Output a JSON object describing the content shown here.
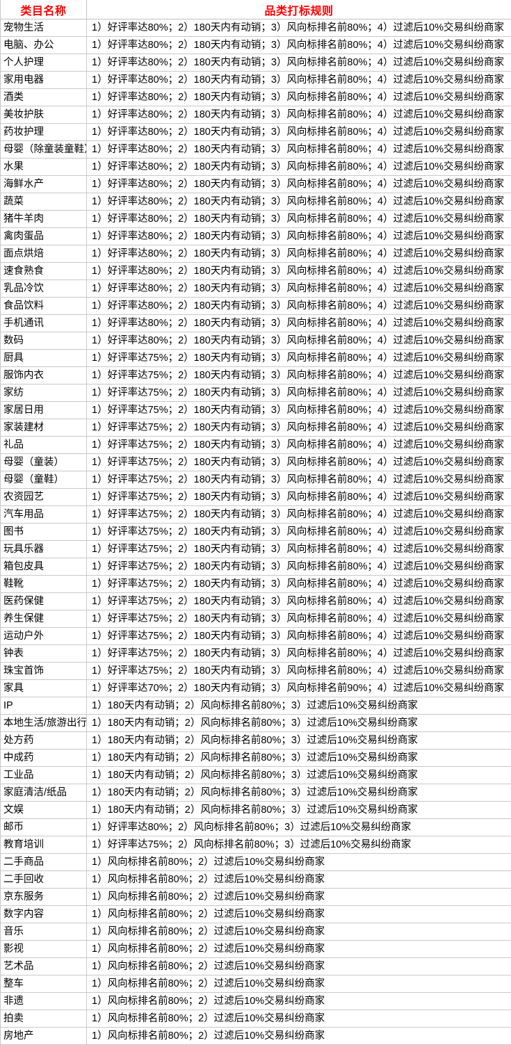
{
  "table": {
    "columns": [
      {
        "key": "name",
        "label": "类目名称"
      },
      {
        "key": "rule",
        "label": "品类打标规则"
      }
    ],
    "header_text_color": "#ff0000",
    "border_color": "#c8c8c8",
    "rows": [
      {
        "name": "宠物生活",
        "rule": "1）好评率达80%；2）180天内有动销；3）风向标排名前80%；4）过滤后10%交易纠纷商家"
      },
      {
        "name": "电脑、办公",
        "rule": "1）好评率达80%；2）180天内有动销；3）风向标排名前80%；4）过滤后10%交易纠纷商家"
      },
      {
        "name": "个人护理",
        "rule": "1）好评率达80%；2）180天内有动销；3）风向标排名前80%；4）过滤后10%交易纠纷商家"
      },
      {
        "name": "家用电器",
        "rule": "1）好评率达80%；2）180天内有动销；3）风向标排名前80%；4）过滤后10%交易纠纷商家"
      },
      {
        "name": "酒类",
        "rule": "1）好评率达80%；2）180天内有动销；3）风向标排名前80%；4）过滤后10%交易纠纷商家"
      },
      {
        "name": "美妆护肤",
        "rule": "1）好评率达80%；2）180天内有动销；3）风向标排名前80%；4）过滤后10%交易纠纷商家"
      },
      {
        "name": "药妆护理",
        "rule": "1）好评率达80%；2）180天内有动销；3）风向标排名前80%；4）过滤后10%交易纠纷商家"
      },
      {
        "name": "母婴（除童装童鞋）",
        "rule": "1）好评率达80%；2）180天内有动销；3）风向标排名前80%；4）过滤后10%交易纠纷商家"
      },
      {
        "name": "水果",
        "rule": "1）好评率达80%；2）180天内有动销；3）风向标排名前80%；4）过滤后10%交易纠纷商家"
      },
      {
        "name": "海鲜水产",
        "rule": "1）好评率达80%；2）180天内有动销；3）风向标排名前80%；4）过滤后10%交易纠纷商家"
      },
      {
        "name": "蔬菜",
        "rule": "1）好评率达80%；2）180天内有动销；3）风向标排名前80%；4）过滤后10%交易纠纷商家"
      },
      {
        "name": "猪牛羊肉",
        "rule": "1）好评率达80%；2）180天内有动销；3）风向标排名前80%；4）过滤后10%交易纠纷商家"
      },
      {
        "name": "禽肉蛋品",
        "rule": "1）好评率达80%；2）180天内有动销；3）风向标排名前80%；4）过滤后10%交易纠纷商家"
      },
      {
        "name": "面点烘焙",
        "rule": "1）好评率达80%；2）180天内有动销；3）风向标排名前80%；4）过滤后10%交易纠纷商家"
      },
      {
        "name": "速食熟食",
        "rule": "1）好评率达80%；2）180天内有动销；3）风向标排名前80%；4）过滤后10%交易纠纷商家"
      },
      {
        "name": "乳品冷饮",
        "rule": "1）好评率达80%；2）180天内有动销；3）风向标排名前80%；4）过滤后10%交易纠纷商家"
      },
      {
        "name": "食品饮料",
        "rule": "1）好评率达80%；2）180天内有动销；3）风向标排名前80%；4）过滤后10%交易纠纷商家"
      },
      {
        "name": "手机通讯",
        "rule": "1）好评率达80%；2）180天内有动销；3）风向标排名前80%；4）过滤后10%交易纠纷商家"
      },
      {
        "name": "数码",
        "rule": "1）好评率达80%；2）180天内有动销；3）风向标排名前80%；4）过滤后10%交易纠纷商家"
      },
      {
        "name": "厨具",
        "rule": "1）好评率达75%；2）180天内有动销；3）风向标排名前80%；4）过滤后10%交易纠纷商家"
      },
      {
        "name": "服饰内衣",
        "rule": "1）好评率达75%；2）180天内有动销；3）风向标排名前80%；4）过滤后10%交易纠纷商家"
      },
      {
        "name": "家纺",
        "rule": "1）好评率达75%；2）180天内有动销；3）风向标排名前80%；4）过滤后10%交易纠纷商家"
      },
      {
        "name": "家居日用",
        "rule": "1）好评率达75%；2）180天内有动销；3）风向标排名前80%；4）过滤后10%交易纠纷商家"
      },
      {
        "name": "家装建材",
        "rule": "1）好评率达75%；2）180天内有动销；3）风向标排名前80%；4）过滤后10%交易纠纷商家"
      },
      {
        "name": "礼品",
        "rule": "1）好评率达75%；2）180天内有动销；3）风向标排名前80%；4）过滤后10%交易纠纷商家"
      },
      {
        "name": "母婴（童装）",
        "rule": "1）好评率达75%；2）180天内有动销；3）风向标排名前80%；4）过滤后10%交易纠纷商家"
      },
      {
        "name": "母婴（童鞋）",
        "rule": "1）好评率达75%；2）180天内有动销；3）风向标排名前80%；4）过滤后10%交易纠纷商家"
      },
      {
        "name": "农资园艺",
        "rule": "1）好评率达75%；2）180天内有动销；3）风向标排名前80%；4）过滤后10%交易纠纷商家"
      },
      {
        "name": "汽车用品",
        "rule": "1）好评率达75%；2）180天内有动销；3）风向标排名前80%；4）过滤后10%交易纠纷商家"
      },
      {
        "name": "图书",
        "rule": "1）好评率达75%；2）180天内有动销；3）风向标排名前80%；4）过滤后10%交易纠纷商家"
      },
      {
        "name": "玩具乐器",
        "rule": "1）好评率达75%；2）180天内有动销；3）风向标排名前80%；4）过滤后10%交易纠纷商家"
      },
      {
        "name": "箱包皮具",
        "rule": "1）好评率达75%；2）180天内有动销；3）风向标排名前80%；4）过滤后10%交易纠纷商家"
      },
      {
        "name": "鞋靴",
        "rule": "1）好评率达75%；2）180天内有动销；3）风向标排名前80%；4）过滤后10%交易纠纷商家"
      },
      {
        "name": "医药保健",
        "rule": "1）好评率达75%；2）180天内有动销；3）风向标排名前80%；4）过滤后10%交易纠纷商家"
      },
      {
        "name": "养生保健",
        "rule": "1）好评率达75%；2）180天内有动销；3）风向标排名前80%；4）过滤后10%交易纠纷商家"
      },
      {
        "name": "运动户外",
        "rule": "1）好评率达75%；2）180天内有动销；3）风向标排名前80%；4）过滤后10%交易纠纷商家"
      },
      {
        "name": "钟表",
        "rule": "1）好评率达75%；2）180天内有动销；3）风向标排名前80%；4）过滤后10%交易纠纷商家"
      },
      {
        "name": "珠宝首饰",
        "rule": "1）好评率达75%；2）180天内有动销；3）风向标排名前80%；4）过滤后10%交易纠纷商家"
      },
      {
        "name": "家具",
        "rule": "1）好评率达70%；2）180天内有动销；3）风向标排名前90%；4）过滤后10%交易纠纷商家"
      },
      {
        "name": "IP",
        "rule": "1）180天内有动销；2）风向标排名前80%；3）过滤后10%交易纠纷商家"
      },
      {
        "name": "本地生活/旅游出行",
        "rule": "1）180天内有动销；2）风向标排名前80%；3）过滤后10%交易纠纷商家"
      },
      {
        "name": "处方药",
        "rule": "1）180天内有动销；2）风向标排名前80%；3）过滤后10%交易纠纷商家"
      },
      {
        "name": "中成药",
        "rule": "1）180天内有动销；2）风向标排名前80%；3）过滤后10%交易纠纷商家"
      },
      {
        "name": "工业品",
        "rule": "1）180天内有动销；2）风向标排名前80%；3）过滤后10%交易纠纷商家"
      },
      {
        "name": "家庭清洁/纸品",
        "rule": "1）180天内有动销；2）风向标排名前80%；3）过滤后10%交易纠纷商家"
      },
      {
        "name": "文娱",
        "rule": "1）180天内有动销；2）风向标排名前80%；3）过滤后10%交易纠纷商家"
      },
      {
        "name": "邮币",
        "rule": "1）好评率达80%；2）风向标排名前80%；3）过滤后10%交易纠纷商家"
      },
      {
        "name": "教育培训",
        "rule": "1）好评率达75%；2）风向标排名前80%；3）过滤后10%交易纠纷商家"
      },
      {
        "name": "二手商品",
        "rule": "1）风向标排名前80%；2）过滤后10%交易纠纷商家"
      },
      {
        "name": "二手回收",
        "rule": "1）风向标排名前80%；2）过滤后10%交易纠纷商家"
      },
      {
        "name": "京东服务",
        "rule": "1）风向标排名前80%；2）过滤后10%交易纠纷商家"
      },
      {
        "name": "数字内容",
        "rule": "1）风向标排名前80%；2）过滤后10%交易纠纷商家"
      },
      {
        "name": "音乐",
        "rule": "1）风向标排名前80%；2）过滤后10%交易纠纷商家"
      },
      {
        "name": "影视",
        "rule": "1）风向标排名前80%；2）过滤后10%交易纠纷商家"
      },
      {
        "name": "艺术品",
        "rule": "1）风向标排名前80%；2）过滤后10%交易纠纷商家"
      },
      {
        "name": "整车",
        "rule": "1）风向标排名前80%；2）过滤后10%交易纠纷商家"
      },
      {
        "name": "非遗",
        "rule": "1）风向标排名前80%；2）过滤后10%交易纠纷商家"
      },
      {
        "name": "拍卖",
        "rule": "1）风向标排名前80%；2）过滤后10%交易纠纷商家"
      },
      {
        "name": "房地产",
        "rule": "1）风向标排名前80%；2）过滤后10%交易纠纷商家"
      }
    ]
  }
}
